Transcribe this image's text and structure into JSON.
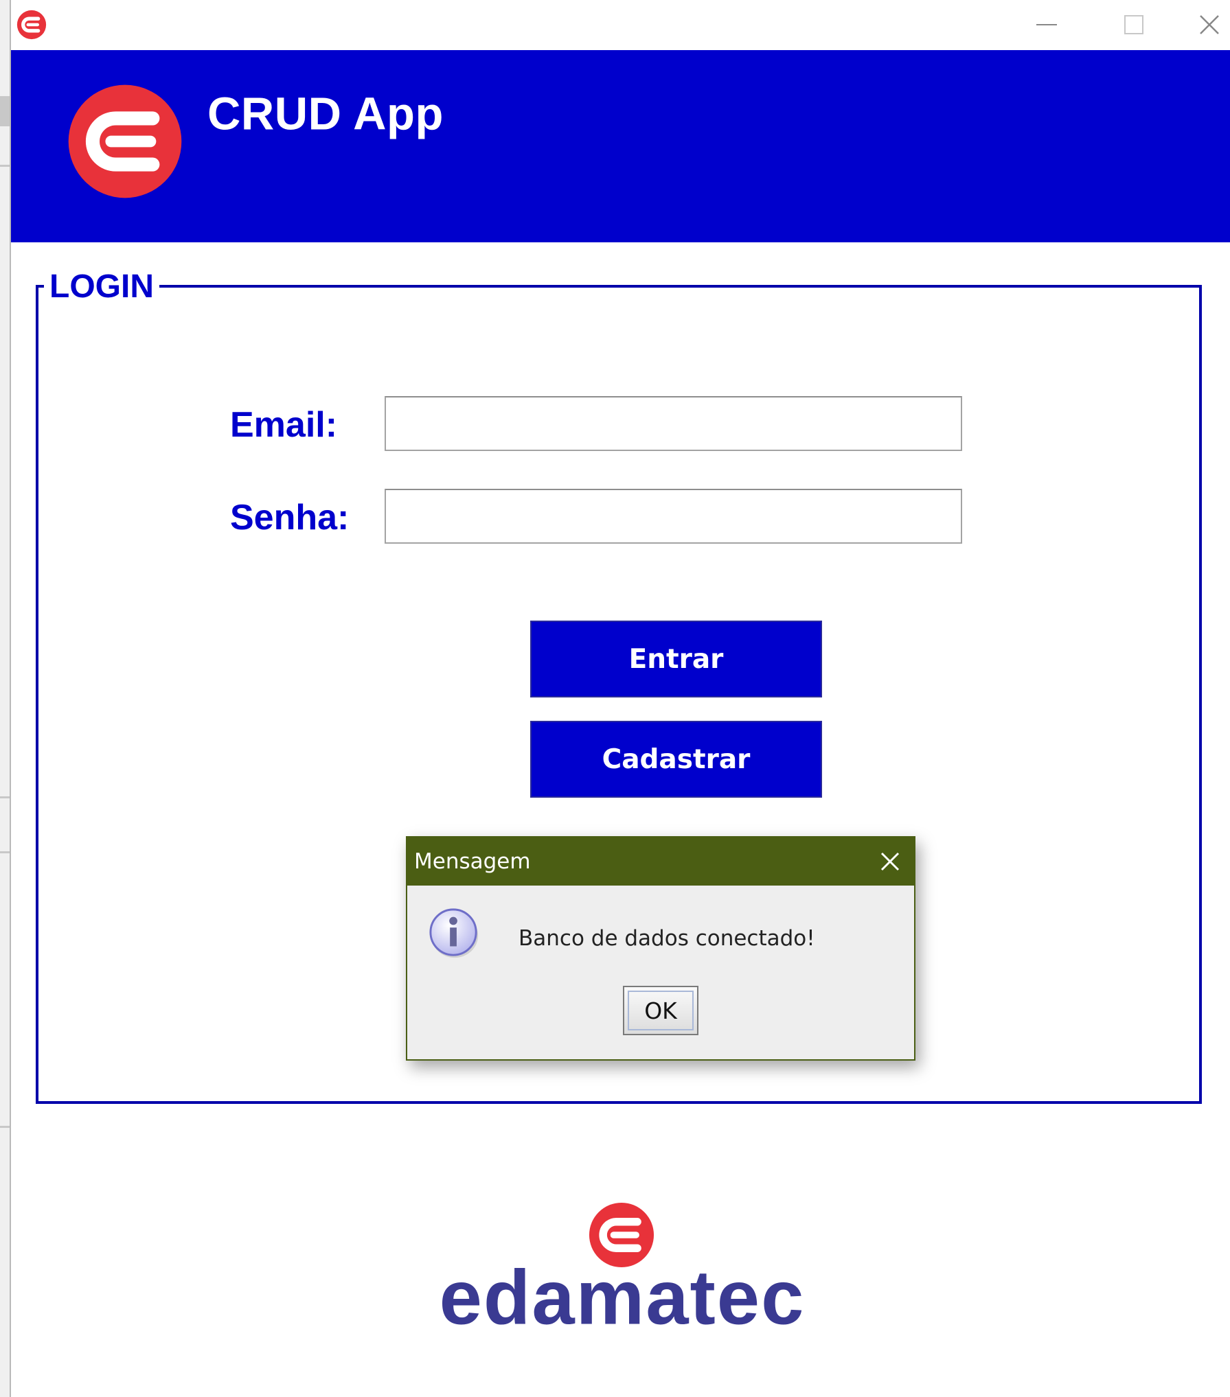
{
  "window": {
    "minimize_icon": "minimize-icon",
    "maximize_icon": "maximize-icon",
    "close_icon": "close-icon"
  },
  "header": {
    "title": "CRUD App",
    "logo_icon": "edamatec-logo-icon",
    "background_color": "#0000cc",
    "logo_color": "#e8323a"
  },
  "login": {
    "legend": "LOGIN",
    "email_label": "Email:",
    "email_value": "",
    "password_label": "Senha:",
    "password_value": "",
    "enter_button": "Entrar",
    "register_button": "Cadastrar"
  },
  "dialog": {
    "title": "Mensagem",
    "icon": "info-icon",
    "message": "Banco de dados conectado!",
    "ok_button": "OK",
    "titlebar_color": "#4b5e13"
  },
  "footer": {
    "brand": "edamatec",
    "brand_color": "#3a3a92"
  }
}
